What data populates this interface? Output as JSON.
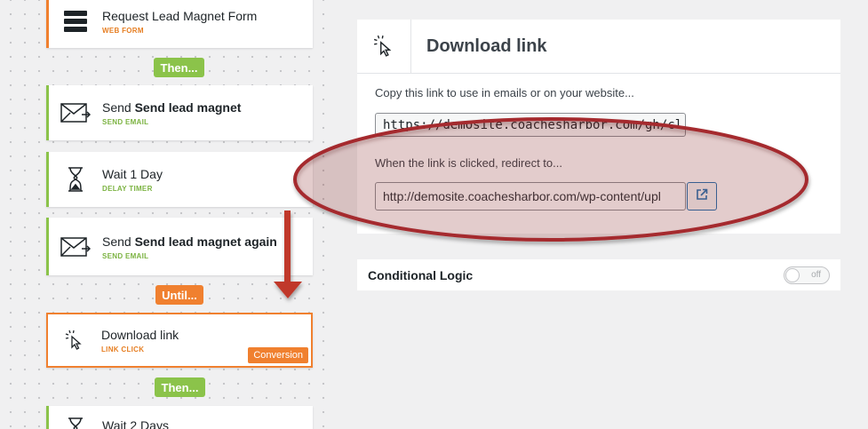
{
  "funnel": {
    "steps": [
      {
        "title": "Request Lead Magnet Form",
        "subtitle": "WEB FORM",
        "icon": "web-form-icon"
      },
      {
        "title_prefix": "Send ",
        "title_bold": "Send lead magnet",
        "subtitle": "SEND EMAIL",
        "icon": "envelope-icon"
      },
      {
        "title": "Wait 1 Day",
        "subtitle": "DELAY TIMER",
        "icon": "hourglass-icon"
      },
      {
        "title_prefix": "Send ",
        "title_bold": "Send lead magnet again",
        "subtitle": "SEND EMAIL",
        "icon": "envelope-icon"
      },
      {
        "title": "Download link",
        "subtitle": "LINK CLICK",
        "icon": "pointer-click-icon",
        "badge": "Conversion"
      },
      {
        "title": "Wait 2 Days",
        "subtitle": "",
        "icon": "hourglass-icon"
      }
    ],
    "connectors": {
      "then_1": "Then...",
      "until": "Until...",
      "then_2": "Then..."
    }
  },
  "panel": {
    "title": "Download link",
    "copy_label": "Copy this link to use in emails or on your website...",
    "copy_value": "https://demosite.coachesharbor.com/gh/cl",
    "redirect_label": "When the link is clicked, redirect to...",
    "redirect_value": "http://demosite.coachesharbor.com/wp-content/upl"
  },
  "conditional": {
    "title": "Conditional Logic",
    "toggle_label": "off",
    "toggle_state": "off"
  },
  "colors": {
    "green": "#8bc34a",
    "orange": "#f0802f",
    "annotation_red": "#b32d2e",
    "link_blue": "#2271b1"
  }
}
